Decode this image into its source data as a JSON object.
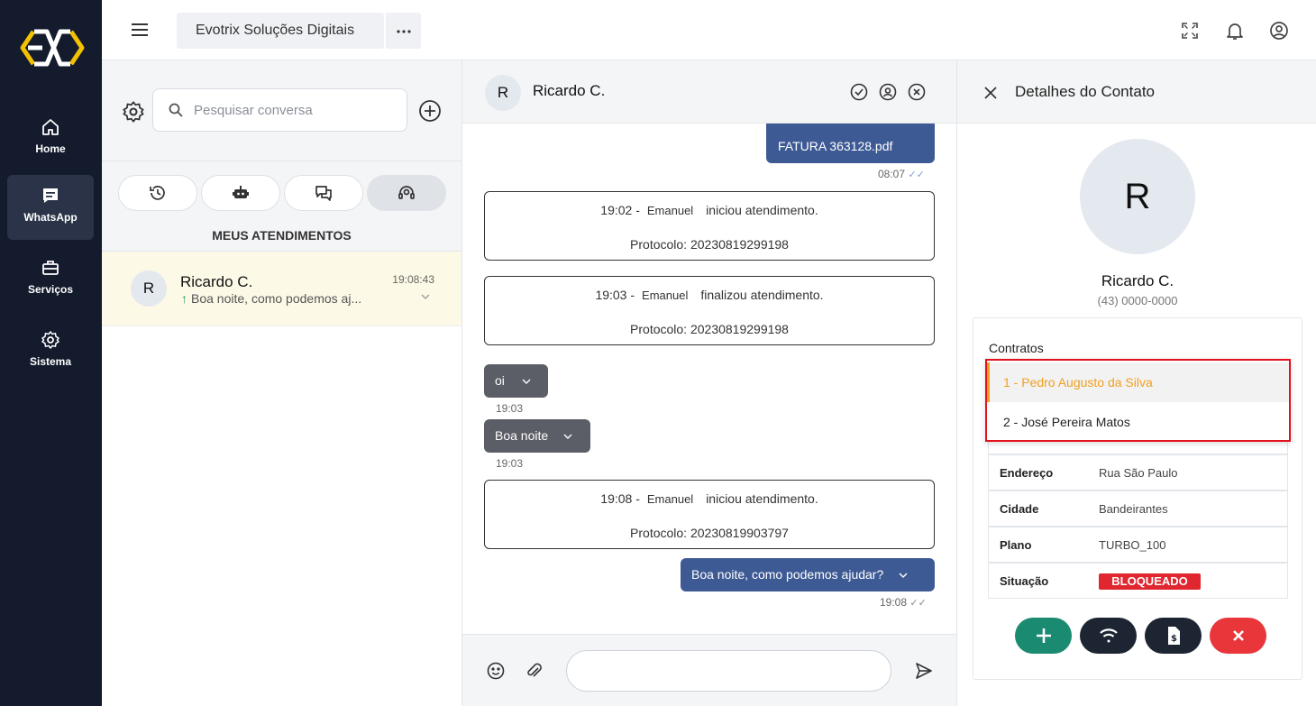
{
  "sidebar": {
    "logo": "EVO",
    "items": [
      {
        "label": "Home",
        "icon": "home-icon"
      },
      {
        "label": "WhatsApp",
        "icon": "chat-icon",
        "active": true
      },
      {
        "label": "Serviços",
        "icon": "briefcase-icon"
      },
      {
        "label": "Sistema",
        "icon": "gear-icon"
      }
    ]
  },
  "topbar": {
    "company": "Evotrix Soluções Digitais",
    "more_label": "···"
  },
  "conversations": {
    "search_placeholder": "Pesquisar conversa",
    "section_title": "MEUS ATENDIMENTOS",
    "items": [
      {
        "avatar": "R",
        "name": "Ricardo C.",
        "preview": "Boa noite, como podemos aj...",
        "time": "19:08:43"
      }
    ]
  },
  "chat": {
    "contact_initial": "R",
    "contact_name": "Ricardo C.",
    "attachment": {
      "name": "FATURA 363128.pdf",
      "time": "08:07"
    },
    "system_events": [
      {
        "time": "19:02 -",
        "agent": "Emanuel",
        "action": "iniciou atendimento.",
        "protocol": "Protocolo: 20230819299198"
      },
      {
        "time": "19:03 -",
        "agent": "Emanuel",
        "action": "finalizou atendimento.",
        "protocol": "Protocolo: 20230819299198"
      },
      {
        "time": "19:08 -",
        "agent": "Emanuel",
        "action": "iniciou atendimento.",
        "protocol": "Protocolo: 20230819903797"
      }
    ],
    "incoming": [
      {
        "text": "oi",
        "time": "19:03"
      },
      {
        "text": "Boa noite",
        "time": "19:03"
      }
    ],
    "outgoing_reply": {
      "text": "Boa noite, como podemos ajudar?",
      "time": "19:08"
    }
  },
  "details": {
    "title": "Detalhes do Contato",
    "avatar": "R",
    "name": "Ricardo C.",
    "phone": "(43) 0000-0000",
    "contracts_label": "Contratos",
    "contract_options": [
      {
        "label": "1 - Pedro Augusto da Silva",
        "highlighted": true
      },
      {
        "label": "2 - José Pereira Matos",
        "highlighted": false
      }
    ],
    "fields": [
      {
        "key": "Endereço",
        "value": "Rua São Paulo"
      },
      {
        "key": "Cidade",
        "value": "Bandeirantes"
      },
      {
        "key": "Plano",
        "value": "TURBO_100"
      },
      {
        "key": "Situação",
        "value": "BLOQUEADO"
      }
    ]
  },
  "colors": {
    "sidebar_bg": "#141b2d",
    "outgoing_bubble": "#3e5a95",
    "incoming_bubble": "#5b5e66",
    "highlight_option": "#f0a020",
    "status_red": "#e0262e",
    "action_green": "#1a8a70",
    "action_dark": "#1d2533",
    "action_red": "#e8363b"
  }
}
